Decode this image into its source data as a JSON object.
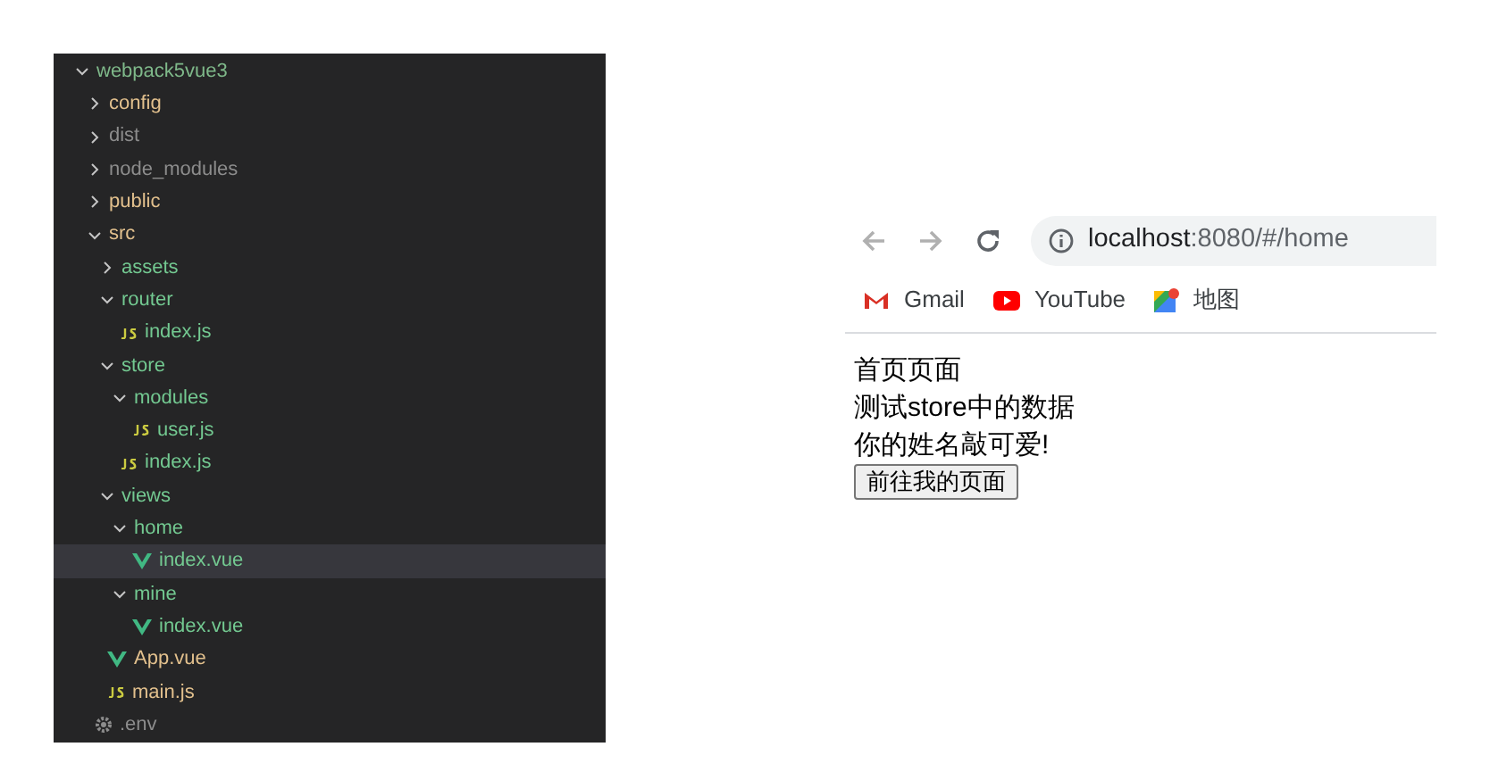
{
  "explorer": {
    "tree": [
      {
        "name": "webpack5vue3",
        "kind": "folder",
        "expanded": true,
        "selected": false,
        "color": "#7fb98a",
        "children": [
          {
            "name": "config",
            "kind": "folder",
            "expanded": false,
            "selected": false,
            "color": "#e2c08d"
          },
          {
            "name": "dist",
            "kind": "folder",
            "expanded": false,
            "selected": false,
            "color": "#8c8c8c"
          },
          {
            "name": "node_modules",
            "kind": "folder",
            "expanded": false,
            "selected": false,
            "color": "#8c8c8c"
          },
          {
            "name": "public",
            "kind": "folder",
            "expanded": false,
            "selected": false,
            "color": "#e2c08d"
          },
          {
            "name": "src",
            "kind": "folder",
            "expanded": true,
            "selected": false,
            "color": "#e2c08d",
            "children": [
              {
                "name": "assets",
                "kind": "folder",
                "expanded": false,
                "selected": false,
                "color": "#73c991"
              },
              {
                "name": "router",
                "kind": "folder",
                "expanded": true,
                "selected": false,
                "color": "#73c991",
                "children": [
                  {
                    "name": "index.js",
                    "kind": "js",
                    "selected": false,
                    "color": "#73c991"
                  }
                ]
              },
              {
                "name": "store",
                "kind": "folder",
                "expanded": true,
                "selected": false,
                "color": "#73c991",
                "children": [
                  {
                    "name": "modules",
                    "kind": "folder",
                    "expanded": true,
                    "selected": false,
                    "color": "#73c991",
                    "children": [
                      {
                        "name": "user.js",
                        "kind": "js",
                        "selected": false,
                        "color": "#73c991"
                      }
                    ]
                  },
                  {
                    "name": "index.js",
                    "kind": "js",
                    "selected": false,
                    "color": "#73c991"
                  }
                ]
              },
              {
                "name": "views",
                "kind": "folder",
                "expanded": true,
                "selected": false,
                "color": "#73c991",
                "children": [
                  {
                    "name": "home",
                    "kind": "folder",
                    "expanded": true,
                    "selected": false,
                    "color": "#73c991",
                    "children": [
                      {
                        "name": "index.vue",
                        "kind": "vue",
                        "selected": true,
                        "color": "#73c991"
                      }
                    ]
                  },
                  {
                    "name": "mine",
                    "kind": "folder",
                    "expanded": true,
                    "selected": false,
                    "color": "#73c991",
                    "children": [
                      {
                        "name": "index.vue",
                        "kind": "vue",
                        "selected": false,
                        "color": "#73c991"
                      }
                    ]
                  }
                ]
              },
              {
                "name": "App.vue",
                "kind": "vue",
                "selected": false,
                "color": "#e2c08d"
              },
              {
                "name": "main.js",
                "kind": "js",
                "selected": false,
                "color": "#e2c08d"
              }
            ]
          },
          {
            "name": ".env",
            "kind": "config",
            "selected": false,
            "color": "#8c8c8c"
          }
        ]
      }
    ]
  },
  "browser": {
    "url_host": "localhost",
    "url_rest": ":8080/#/home",
    "bookmarks": [
      {
        "label": "Gmail",
        "kind": "gmail"
      },
      {
        "label": "YouTube",
        "kind": "youtube"
      },
      {
        "label": "地图",
        "kind": "maps"
      }
    ],
    "content": {
      "lines": [
        "首页页面",
        "测试store中的数据",
        "你的姓名敲可爱!"
      ],
      "button": "前往我的页面"
    }
  }
}
